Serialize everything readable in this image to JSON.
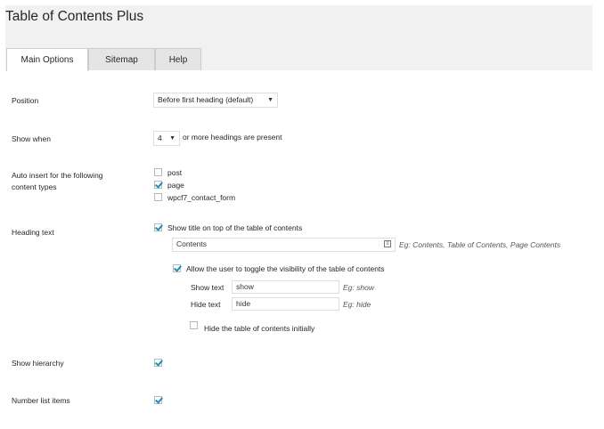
{
  "page": {
    "title": "Table of Contents Plus"
  },
  "tabs": [
    {
      "label": "Main Options",
      "active": true
    },
    {
      "label": "Sitemap",
      "active": false
    },
    {
      "label": "Help",
      "active": false
    }
  ],
  "settings": {
    "position": {
      "label": "Position",
      "value": "Before first heading (default)"
    },
    "show_when": {
      "label": "Show when",
      "value": "4",
      "suffix": "or more headings are present"
    },
    "auto_insert": {
      "label_line1": "Auto insert for the following",
      "label_line2": "content types",
      "options": [
        {
          "label": "post",
          "checked": false
        },
        {
          "label": "page",
          "checked": true
        },
        {
          "label": "wpcf7_contact_form",
          "checked": false
        }
      ]
    },
    "heading_text": {
      "label": "Heading text",
      "show_title_label": "Show title on top of the table of contents",
      "show_title_checked": true,
      "title_value": "Contents",
      "title_hint": "Eg: Contents, Table of Contents, Page Contents",
      "toggle_label": "Allow the user to toggle the visibility of the table of contents",
      "toggle_checked": true,
      "show_text_label": "Show text",
      "show_text_value": "show",
      "show_text_hint": "Eg: show",
      "hide_text_label": "Hide text",
      "hide_text_value": "hide",
      "hide_text_hint": "Eg: hide",
      "hide_initially_label": "Hide the table of contents initially",
      "hide_initially_checked": false
    },
    "show_hierarchy": {
      "label": "Show hierarchy",
      "checked": true
    },
    "number_list": {
      "label": "Number list items",
      "checked": true
    }
  },
  "colors": {
    "accent": "#1e8cbe",
    "header_bg": "#f1f1f1"
  }
}
